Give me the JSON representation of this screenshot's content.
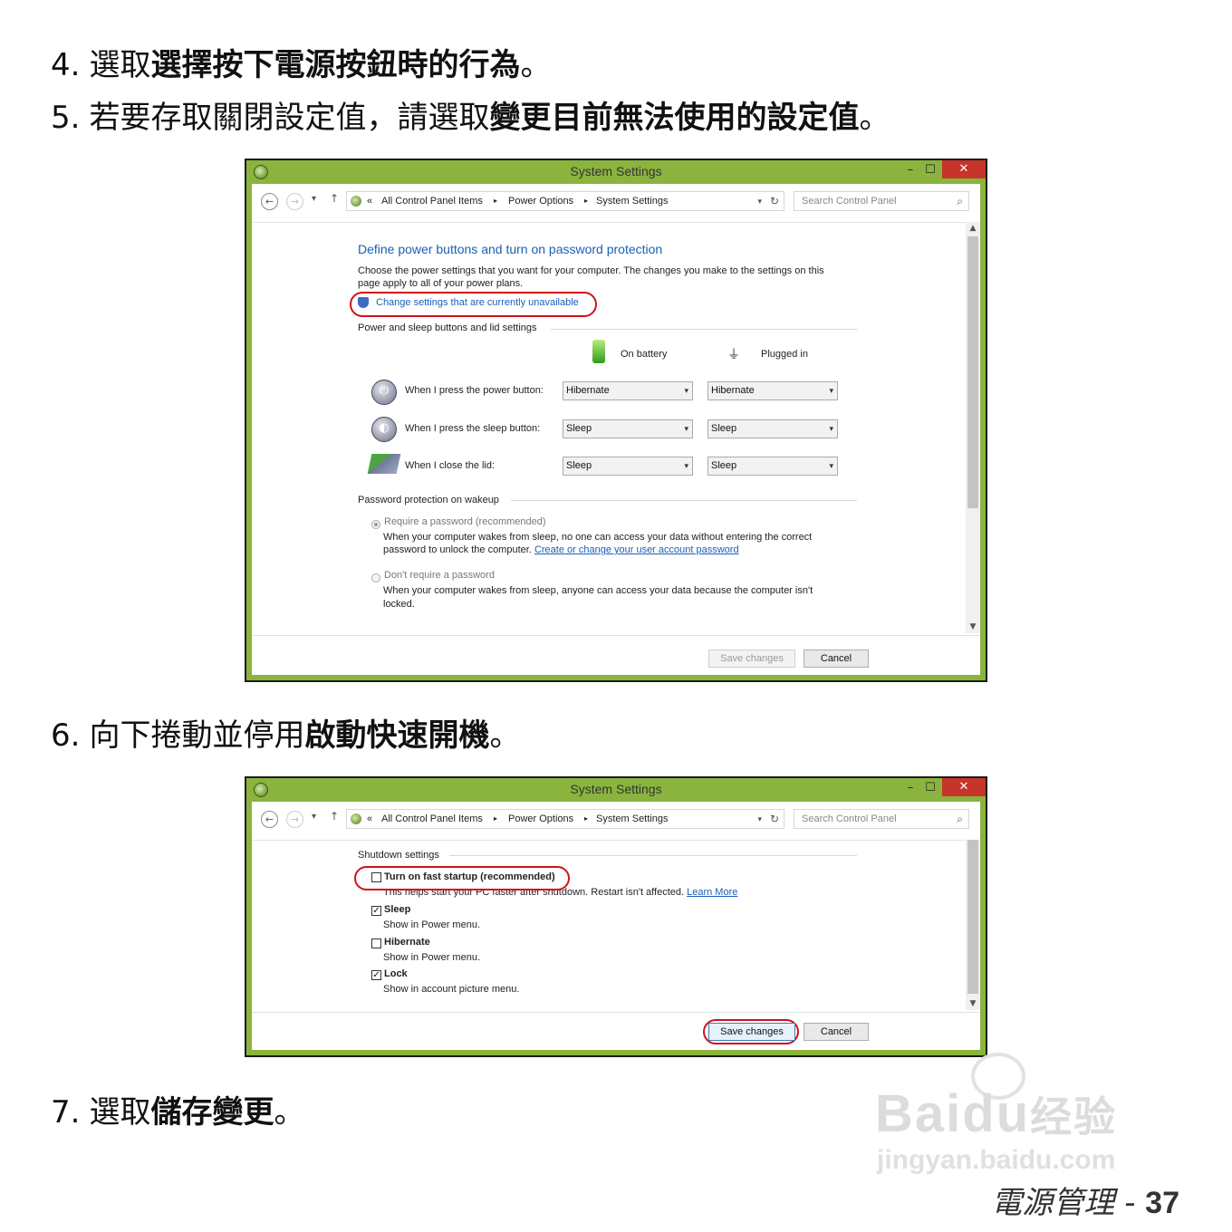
{
  "steps": {
    "s4": {
      "num": "4.",
      "pre": "選取",
      "em": "選擇按下電源按鈕時的行為",
      "post": "。"
    },
    "s5": {
      "num": "5.",
      "pre": "若要存取關閉設定值，請選取",
      "em": "變更目前無法使用的設定值",
      "post": "。"
    },
    "s6": {
      "num": "6.",
      "pre": "向下捲動並停用",
      "em": "啟動快速開機",
      "post": "。"
    },
    "s7": {
      "num": "7.",
      "pre": "選取",
      "em": "儲存變更",
      "post": "。"
    }
  },
  "window": {
    "title": "System Settings",
    "min": "–",
    "max": "☐",
    "close": "✕",
    "breadcrumb": {
      "prefix": "«",
      "items": [
        "All Control Panel Items",
        "Power Options",
        "System Settings"
      ]
    },
    "search_placeholder": "Search Control Panel"
  },
  "win1": {
    "heading": "Define power buttons and turn on password protection",
    "desc1": "Choose the power settings that you want for your computer. The changes you make to the settings on this",
    "desc2": "page apply to all of your power plans.",
    "change_link": "Change settings that are currently unavailable",
    "group1": "Power and sleep buttons and lid settings",
    "col_battery": "On battery",
    "col_plugged": "Plugged in",
    "rows": [
      {
        "label": "When I press the power button:",
        "battery": "Hibernate",
        "plugged": "Hibernate"
      },
      {
        "label": "When I press the sleep button:",
        "battery": "Sleep",
        "plugged": "Sleep"
      },
      {
        "label": "When I close the lid:",
        "battery": "Sleep",
        "plugged": "Sleep"
      }
    ],
    "group2": "Password protection on wakeup",
    "opt1_label": "Require a password (recommended)",
    "opt1_desc1": "When your computer wakes from sleep, no one can access your data without entering the correct",
    "opt1_desc2": "password to unlock the computer.",
    "opt1_link": "Create or change your user account password",
    "opt2_label": "Don't require a password",
    "opt2_desc1": "When your computer wakes from sleep, anyone can access your data because the computer isn't",
    "opt2_desc2": "locked.",
    "save": "Save changes",
    "cancel": "Cancel"
  },
  "win2": {
    "group": "Shutdown settings",
    "fast_label": "Turn on fast startup (recommended)",
    "fast_desc": "This helps start your PC faster after shutdown. Restart isn't affected.",
    "learn_more": "Learn More",
    "sleep_label": "Sleep",
    "sleep_desc": "Show in Power menu.",
    "hib_label": "Hibernate",
    "hib_desc": "Show in Power menu.",
    "lock_label": "Lock",
    "lock_desc": "Show in account picture menu.",
    "check": "✓",
    "save": "Save changes",
    "cancel": "Cancel"
  },
  "watermark": {
    "brand": "Bai",
    "brand2": "du",
    "suffix": "经验",
    "url": "jingyan.baidu.com"
  },
  "footer": {
    "section": "電源管理",
    "dash": " - ",
    "page": "37"
  },
  "colors": {
    "window_frame": "#8ab43e",
    "close_button": "#c7342a",
    "highlight_oval": "#d0121b",
    "link": "#1a5fb4"
  }
}
